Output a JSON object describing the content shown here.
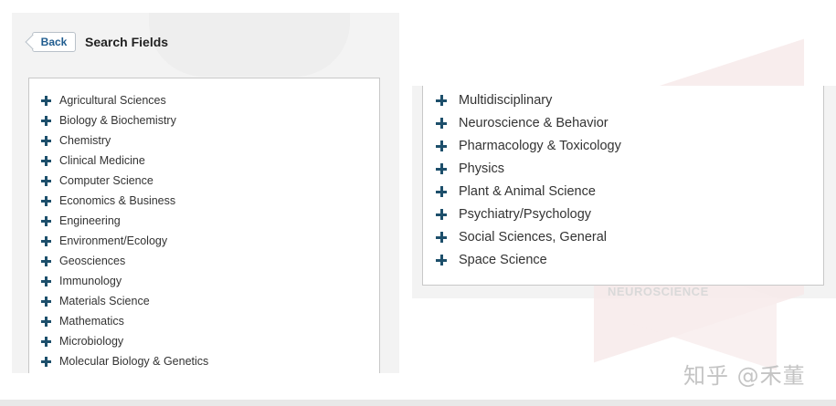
{
  "left_panel": {
    "back_label": "Back",
    "title": "Search Fields",
    "items": [
      {
        "label": "Agricultural Sciences"
      },
      {
        "label": "Biology & Biochemistry"
      },
      {
        "label": "Chemistry"
      },
      {
        "label": "Clinical Medicine"
      },
      {
        "label": "Computer Science"
      },
      {
        "label": "Economics & Business"
      },
      {
        "label": "Engineering"
      },
      {
        "label": "Environment/Ecology"
      },
      {
        "label": "Geosciences"
      },
      {
        "label": "Immunology"
      },
      {
        "label": "Materials Science"
      },
      {
        "label": "Mathematics"
      },
      {
        "label": "Microbiology"
      },
      {
        "label": "Molecular Biology & Genetics"
      }
    ]
  },
  "right_panel": {
    "items": [
      {
        "label": "Multidisciplinary"
      },
      {
        "label": "Neuroscience & Behavior"
      },
      {
        "label": "Pharmacology & Toxicology"
      },
      {
        "label": "Physics"
      },
      {
        "label": "Plant & Animal Science"
      },
      {
        "label": "Psychiatry/Psychology"
      },
      {
        "label": "Social Sciences, General"
      },
      {
        "label": "Space Science"
      }
    ],
    "background_text": "NEUROSCIENCE"
  },
  "watermark": "知乎 @禾董",
  "icons": {
    "expand": "plus-icon",
    "back": "chevron-left-icon"
  },
  "colors": {
    "icon": "#1d4f6b",
    "back_text": "#1f5c8f"
  }
}
